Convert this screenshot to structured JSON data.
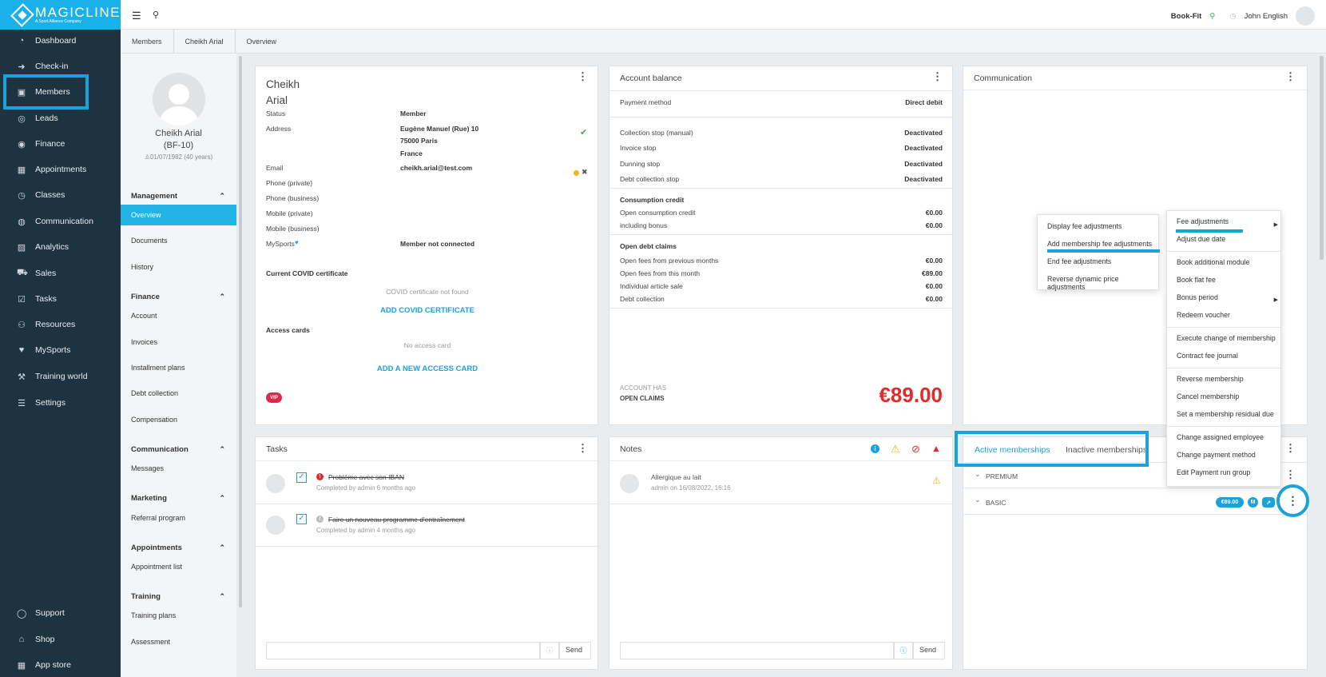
{
  "app": {
    "brand": "MAGICLINE",
    "brand_sub": "A Sport Alliance Company"
  },
  "topbar": {
    "studio": "Book-Fit",
    "user": "John English"
  },
  "nav": [
    {
      "label": "Dashboard",
      "icon": "dashboard-icon",
      "glyph": "◔"
    },
    {
      "label": "Check-in",
      "icon": "check-in-icon",
      "glyph": "➜"
    },
    {
      "label": "Members",
      "icon": "members-icon",
      "glyph": "▣"
    },
    {
      "label": "Leads",
      "icon": "leads-icon",
      "glyph": "◎"
    },
    {
      "label": "Finance",
      "icon": "finance-icon",
      "glyph": "◉"
    },
    {
      "label": "Appointments",
      "icon": "calendar-icon",
      "glyph": "▦"
    },
    {
      "label": "Classes",
      "icon": "stopwatch-icon",
      "glyph": "◷"
    },
    {
      "label": "Communication",
      "icon": "chat-icon",
      "glyph": "◍"
    },
    {
      "label": "Analytics",
      "icon": "chart-icon",
      "glyph": "▨"
    },
    {
      "label": "Sales",
      "icon": "cart-icon",
      "glyph": "⛟"
    },
    {
      "label": "Tasks",
      "icon": "checkbox-icon",
      "glyph": "☑"
    },
    {
      "label": "Resources",
      "icon": "people-icon",
      "glyph": "⚇"
    },
    {
      "label": "MySports",
      "icon": "mysports-icon",
      "glyph": "♥"
    },
    {
      "label": "Training world",
      "icon": "dumbbell-icon",
      "glyph": "⚒"
    },
    {
      "label": "Settings",
      "icon": "sliders-icon",
      "glyph": "☰"
    }
  ],
  "nav_bottom": [
    {
      "label": "Support",
      "icon": "support-icon",
      "glyph": "◯"
    },
    {
      "label": "Shop",
      "icon": "shop-icon",
      "glyph": "⌂"
    },
    {
      "label": "App store",
      "icon": "grid-icon",
      "glyph": "▦"
    }
  ],
  "breadcrumb": [
    "Members",
    "Cheikh Arial",
    "Overview"
  ],
  "profile": {
    "name": "Cheikh Arial",
    "id": "(BF-10)",
    "dob": "01/07/1982 (40 years)"
  },
  "subnav": {
    "sections": [
      {
        "title": "Management",
        "items": [
          "Overview",
          "Documents",
          "History"
        ]
      },
      {
        "title": "Finance",
        "items": [
          "Account",
          "Invoices",
          "Installment plans",
          "Debt collection",
          "Compensation"
        ]
      },
      {
        "title": "Communication",
        "items": [
          "Messages"
        ]
      },
      {
        "title": "Marketing",
        "items": [
          "Referral program"
        ]
      },
      {
        "title": "Appointments",
        "items": [
          "Appointment list"
        ]
      },
      {
        "title": "Training",
        "items": [
          "Training plans",
          "Assessment"
        ]
      }
    ]
  },
  "member": {
    "first": "Cheikh",
    "last": "Arial",
    "fields": [
      {
        "label": "Status",
        "value": "Member"
      },
      {
        "label": "Address",
        "value": "Eugène Manuel (Rue) 10",
        "value2": "75000 Paris",
        "value3": "France"
      },
      {
        "label": "Email",
        "value": "cheikh.arial@test.com"
      },
      {
        "label": "Phone (private)",
        "value": ""
      },
      {
        "label": "Phone (business)",
        "value": ""
      },
      {
        "label": "Mobile (private)",
        "value": ""
      },
      {
        "label": "Mobile (business)",
        "value": ""
      },
      {
        "label": "MySports",
        "value": "Member not connected"
      }
    ],
    "covid_title": "Current COVID certificate",
    "covid_empty": "COVID certificate not found",
    "covid_add": "ADD COVID CERTIFICATE",
    "access_title": "Access cards",
    "access_empty": "No access card",
    "access_add": "ADD A NEW ACCESS CARD",
    "badge": "VIP"
  },
  "account": {
    "title": "Account balance",
    "payment_label": "Payment method",
    "payment_value": "Direct debit",
    "stops": [
      {
        "label": "Collection stop (manual)",
        "value": "Deactivated"
      },
      {
        "label": "Invoice stop",
        "value": "Deactivated"
      },
      {
        "label": "Dunning stop",
        "value": "Deactivated"
      },
      {
        "label": "Debt collection stop",
        "value": "Deactivated"
      }
    ],
    "credit_title": "Consumption credit",
    "credit": [
      {
        "label": "Open consumption credit",
        "value": "€0.00"
      },
      {
        "label": "including bonus",
        "value": "€0.00"
      }
    ],
    "debt_title": "Open debt claims",
    "debt": [
      {
        "label": "Open fees from previous months",
        "value": "€0.00"
      },
      {
        "label": "Open fees from this month",
        "value": "€89.00"
      },
      {
        "label": "Individual article sale",
        "value": "€0.00"
      },
      {
        "label": "Debt collection",
        "value": "€0.00"
      }
    ],
    "footer_line1": "ACCOUNT HAS",
    "footer_line2": "OPEN CLAIMS",
    "total": "€89.00"
  },
  "communication": {
    "title": "Communication"
  },
  "fee_submenu": [
    "Display fee adjustments",
    "Add membership fee adjustments",
    "End fee adjustments",
    "Reverse dynamic price adjustments"
  ],
  "main_menu": [
    [
      "Fee adjustments",
      "Adjust due date"
    ],
    [
      "Book additional module",
      "Book flat fee",
      "Bonus period",
      "Redeem voucher"
    ],
    [
      "Execute change of membership",
      "Contract fee journal"
    ],
    [
      "Reverse membership",
      "Cancel membership",
      "Set a membership residual due"
    ],
    [
      "Change assigned employee",
      "Change payment method",
      "Edit Payment run group"
    ]
  ],
  "tasks": {
    "title": "Tasks",
    "items": [
      {
        "text": "Problème avec son IBAN",
        "sub": "Completed by admin 6 months ago"
      },
      {
        "text": "Faire un nouveau programme d'entraînement",
        "sub": "Completed by admin 4 months ago"
      }
    ],
    "send": "Send"
  },
  "notes": {
    "title": "Notes",
    "items": [
      {
        "text": "Allergique au lait",
        "sub": "admin on 16/08/2022, 16:16"
      }
    ],
    "send": "Send"
  },
  "memberships": {
    "tabs": [
      "Active memberships",
      "Inactive memberships"
    ],
    "items": [
      "PREMIUM",
      "BASIC"
    ],
    "price": "€89.00",
    "m_badge": "M"
  },
  "colors": {
    "accent": "#1ba2db",
    "sidebar": "#1d3340",
    "danger": "#e02b2b"
  }
}
